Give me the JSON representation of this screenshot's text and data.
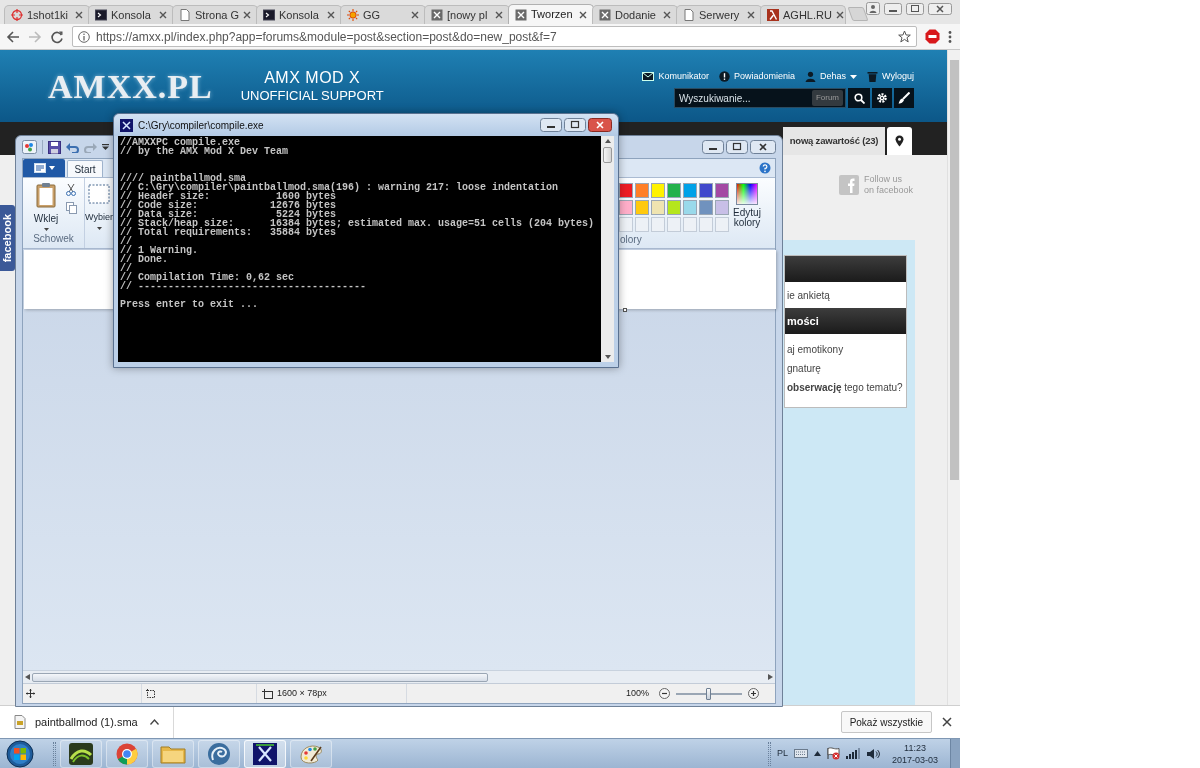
{
  "browser": {
    "tabs": [
      {
        "title": "1shot1ki",
        "selected": false
      },
      {
        "title": "Konsola",
        "selected": false
      },
      {
        "title": "Strona G",
        "selected": false
      },
      {
        "title": "Konsola",
        "selected": false
      },
      {
        "title": "GG",
        "selected": false
      },
      {
        "title": "[nowy pl",
        "selected": false
      },
      {
        "title": "Tworzen",
        "selected": true
      },
      {
        "title": "Dodanie",
        "selected": false
      },
      {
        "title": "Serwery",
        "selected": false
      },
      {
        "title": "AGHL.RU",
        "selected": false
      }
    ],
    "url": "https://amxx.pl/index.php?app=forums&module=post&section=post&do=new_post&f=7"
  },
  "site": {
    "logo": "AMXX.PL",
    "title": "AMX MOD X",
    "subtitle": "UNOFFICIAL SUPPORT",
    "user_links": [
      {
        "label": "Komunikator",
        "dropdown": false
      },
      {
        "label": "Powiadomienia",
        "dropdown": false
      },
      {
        "label": "Dehas",
        "dropdown": true
      },
      {
        "label": "Wyloguj",
        "dropdown": false
      }
    ],
    "search": {
      "placeholder": "Wyszukiwanie...",
      "scope": "Forum"
    },
    "new_content": "nową zawartość (23)",
    "follow": {
      "line1": "Follow us",
      "line2": "on facebook"
    },
    "facebook_tab": "facebook",
    "sidebar_panels": [
      {
        "items": [
          "ie ankietą"
        ]
      },
      {
        "heading": "mości",
        "items": [
          "aj emotikony",
          "gnaturę",
          "**obserwację** tego tematu?"
        ]
      }
    ]
  },
  "paint": {
    "tabs": [
      {
        "label": "Start",
        "selected": true
      }
    ],
    "paste": "Wklej",
    "select": "Wybier",
    "clipboard_group": "Schowek",
    "colors_group": "olory",
    "edit_colors": "Edytuj kolory",
    "palette": [
      {
        "kind": "swatch",
        "color": "#ed1c24"
      },
      {
        "kind": "swatch",
        "color": "#ff7f27"
      },
      {
        "kind": "swatch",
        "color": "#fff200"
      },
      {
        "kind": "swatch",
        "color": "#22b14c"
      },
      {
        "kind": "swatch",
        "color": "#00a2e8"
      },
      {
        "kind": "swatch",
        "color": "#3f48cc"
      },
      {
        "kind": "swatch",
        "color": "#a349a4"
      },
      {
        "kind": "swatch",
        "color": "#ffaec9"
      },
      {
        "kind": "swatch",
        "color": "#ffc90e"
      },
      {
        "kind": "swatch",
        "color": "#efe4b0"
      },
      {
        "kind": "swatch",
        "color": "#b5e61d"
      },
      {
        "kind": "swatch",
        "color": "#99d9ea"
      },
      {
        "kind": "swatch",
        "color": "#7092be"
      },
      {
        "kind": "swatch",
        "color": "#c8bfe7"
      },
      {
        "kind": "empty"
      },
      {
        "kind": "empty"
      },
      {
        "kind": "empty"
      },
      {
        "kind": "empty"
      },
      {
        "kind": "empty"
      },
      {
        "kind": "empty"
      },
      {
        "kind": "empty"
      }
    ],
    "image_size": "1600 × 78px",
    "zoom": "100%",
    "zoom_slider": {
      "level": 0.5
    }
  },
  "console": {
    "title": "C:\\Gry\\compiler\\compile.exe",
    "output": "//AMXXPC compile.exe\n// by the AMX Mod X Dev Team\n\n\n//// paintballmod.sma\n// C:\\Gry\\compiler\\paintballmod.sma(196) : warning 217: loose indentation\n// Header size:           1600 bytes\n// Code size:            12676 bytes\n// Data size:             5224 bytes\n// Stack/heap size:      16384 bytes; estimated max. usage=51 cells (204 bytes)\n// Total requirements:   35884 bytes\n//\n// 1 Warning.\n// Done.\n//\n// Compilation Time: 0,62 sec\n// --------------------------------------\n\nPress enter to exit ..."
  },
  "downloads": {
    "file": "paintballmod (1).sma",
    "show_all": "Pokaż wszystkie"
  },
  "taskbar": {
    "apps": [
      {
        "selected": false
      },
      {
        "selected": false
      },
      {
        "selected": false
      },
      {
        "selected": false
      },
      {
        "selected": true
      },
      {
        "selected": false
      }
    ],
    "language": "PL",
    "time": "11:23",
    "date": "2017-03-03"
  }
}
